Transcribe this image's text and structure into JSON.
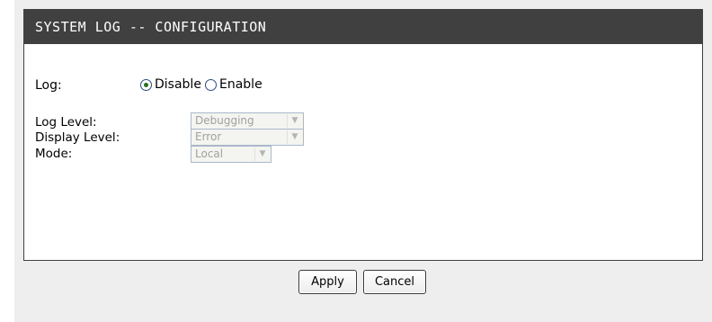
{
  "panel": {
    "title": "SYSTEM LOG -- CONFIGURATION"
  },
  "form": {
    "log_label": "Log:",
    "log_options": [
      "Disable",
      "Enable"
    ],
    "log_selected": "Disable",
    "log_level_label": "Log Level:",
    "log_level_value": "Debugging",
    "display_level_label": "Display Level:",
    "display_level_value": "Error",
    "mode_label": "Mode:",
    "mode_value": "Local"
  },
  "buttons": {
    "apply": "Apply",
    "cancel": "Cancel"
  },
  "icons": {
    "dropdown": "chevron-down-icon"
  }
}
